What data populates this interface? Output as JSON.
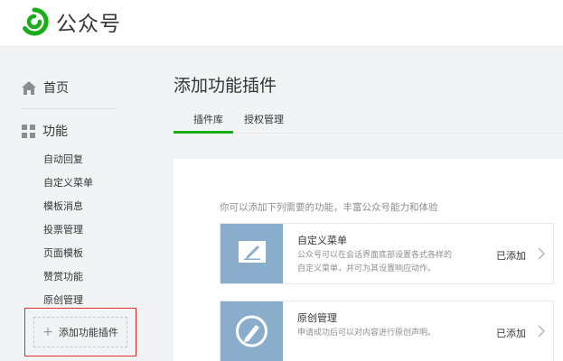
{
  "header": {
    "brand": "公众号"
  },
  "sidebar": {
    "home_label": "首页",
    "function_label": "功能",
    "sub_items": [
      {
        "label": "自动回复"
      },
      {
        "label": "自定义菜单"
      },
      {
        "label": "模板消息"
      },
      {
        "label": "投票管理"
      },
      {
        "label": "页面模板"
      },
      {
        "label": "赞赏功能"
      },
      {
        "label": "原创管理"
      }
    ],
    "add_plugin_label": "添加功能插件"
  },
  "main": {
    "title": "添加功能插件",
    "tabs": [
      {
        "label": "插件库",
        "active": true
      },
      {
        "label": "授权管理",
        "active": false
      }
    ],
    "hint": "你可以添加下列需要的功能，丰富公众号能力和体验",
    "plugins": [
      {
        "name": "自定义菜单",
        "desc_line1": "公众号可以在会话界面底部设置各式各样的",
        "desc_line2": "自定义菜单，并可为其设置响应动作。",
        "status": "已添加",
        "icon": "pencil-note-icon"
      },
      {
        "name": "原创管理",
        "desc_line1": "申请成功后可以对内容进行原创声明。",
        "status": "已添加",
        "icon": "pen-circle-icon"
      }
    ]
  },
  "colors": {
    "accent_green": "#1aad19",
    "highlight_red": "#d8312d",
    "thumb_blue": "#8aadcc",
    "background": "#f2f3f5"
  }
}
